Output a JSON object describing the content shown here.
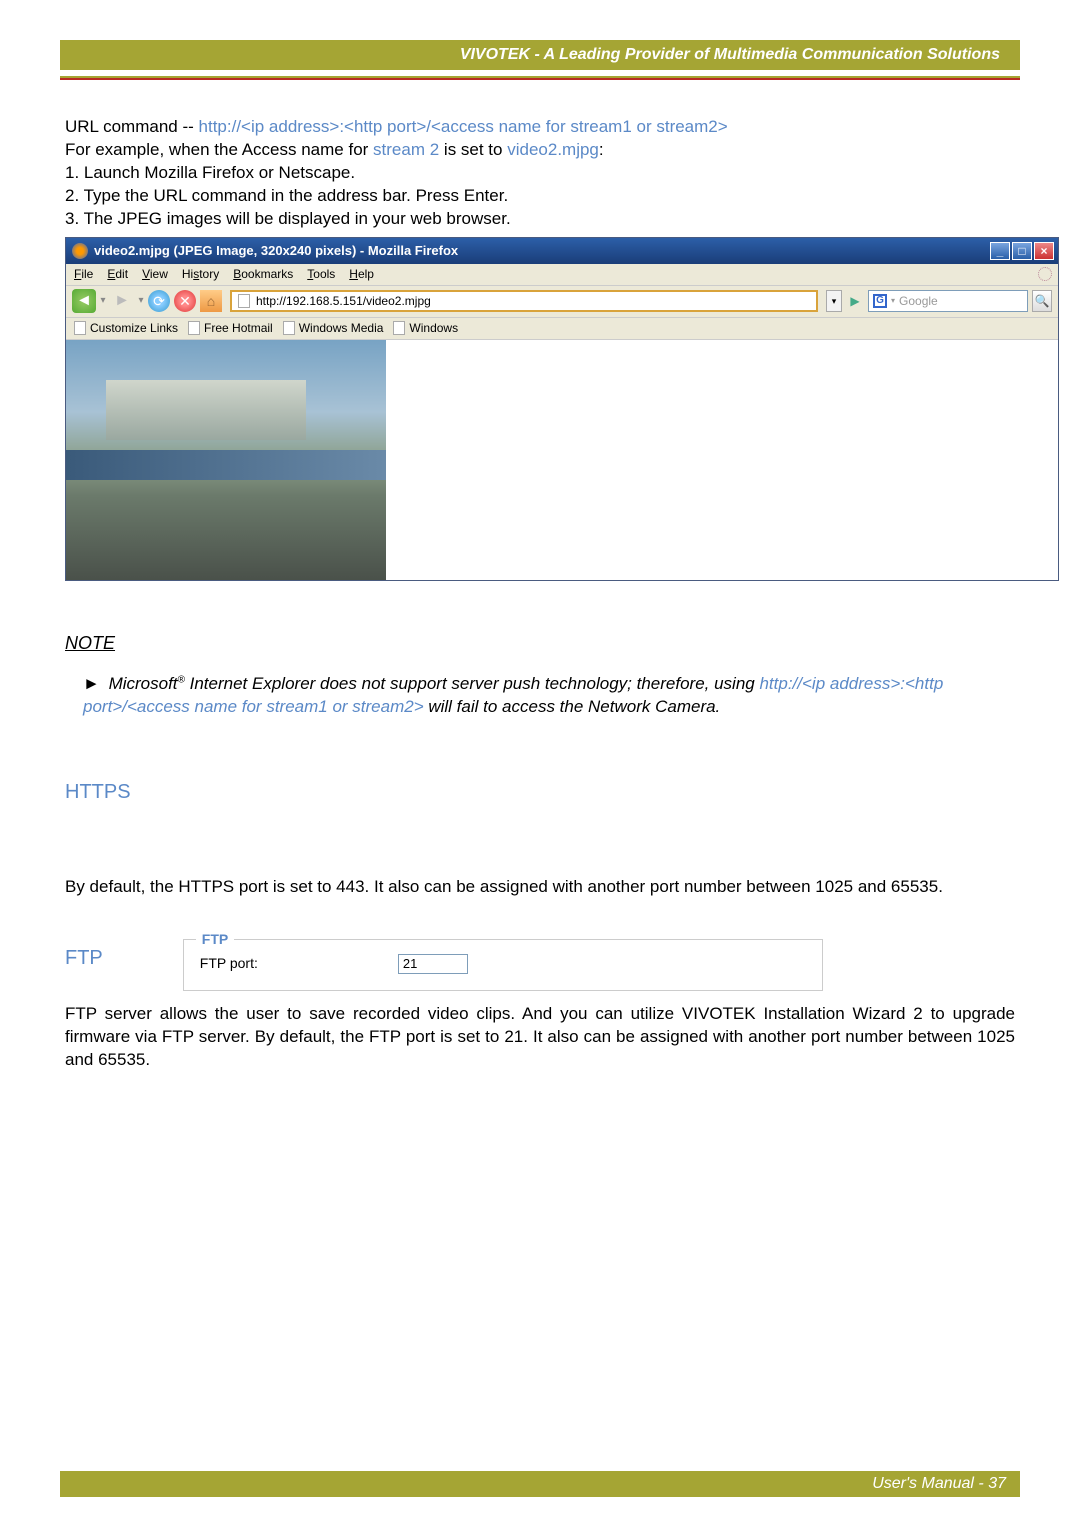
{
  "header": {
    "title": "VIVOTEK - A Leading Provider of Multimedia Communication Solutions"
  },
  "url_cmd": {
    "prefix": "URL command -- ",
    "pattern": "http://<ip address>:<http port>/<access name for stream1 or stream2>",
    "example_prefix": "For example, when the Access name for ",
    "stream": "stream 2",
    "example_mid": " is set to ",
    "video": "video2.mjpg",
    "example_suffix": ":",
    "step1": "1. Launch Mozilla Firefox or Netscape.",
    "step2": "2. Type the URL command in the address bar. Press Enter.",
    "step3": "3. The JPEG images will be displayed in your web browser."
  },
  "firefox": {
    "title": "video2.mjpg (JPEG Image, 320x240 pixels) - Mozilla Firefox",
    "menu": {
      "file": "File",
      "edit": "Edit",
      "view": "View",
      "history": "History",
      "bookmarks": "Bookmarks",
      "tools": "Tools",
      "help": "Help"
    },
    "address": "http://192.168.5.151/video2.mjpg",
    "search_placeholder": "Google",
    "bookmarks_bar": {
      "b1": "Customize Links",
      "b2": "Free Hotmail",
      "b3": "Windows Media",
      "b4": "Windows"
    }
  },
  "note": {
    "title": "NOTE",
    "pre": "Microsoft",
    "reg": "®",
    "mid": " Internet Explorer does not support server push technology; therefore, using ",
    "link": "http://<ip address>:<http port>/<access name for stream1 or stream2>",
    "post": " will fail to access the Network Camera."
  },
  "https": {
    "heading": "HTTPS",
    "body": "By default, the HTTPS port is set to 443. It also can be assigned with another port number between 1025 and 65535."
  },
  "ftp": {
    "heading": "FTP",
    "legend": "FTP",
    "label": "FTP port:",
    "value": "21",
    "body": "FTP server allows the user to save recorded video clips. And you can utilize VIVOTEK Installation Wizard 2 to upgrade firmware via FTP server. By default, the FTP port is set to 21. It also can be assigned with another port number between 1025 and 65535."
  },
  "footer": {
    "text": "User's Manual - 37"
  }
}
